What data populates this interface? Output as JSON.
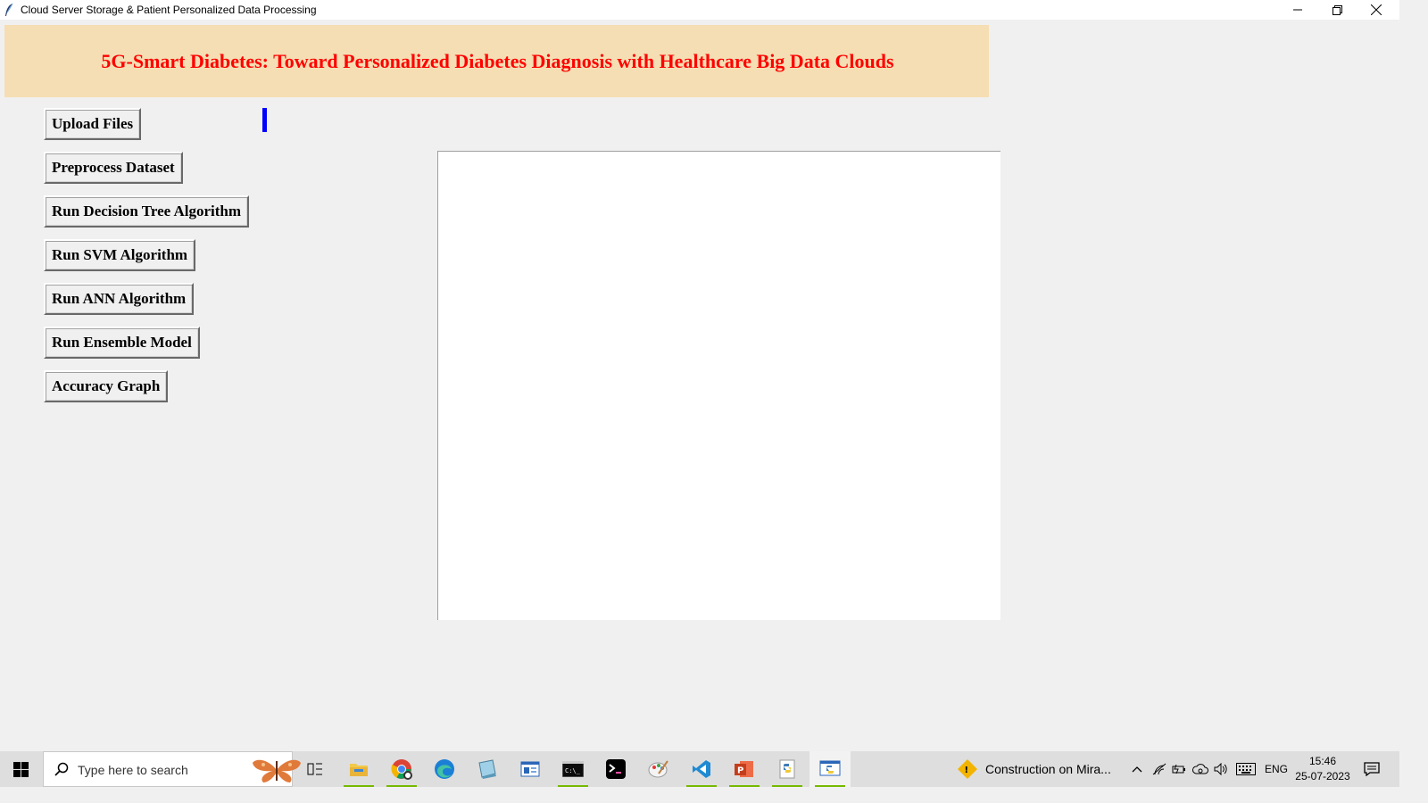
{
  "window": {
    "title": "Cloud Server Storage & Patient Personalized Data Processing",
    "controls": [
      "minimize",
      "restore",
      "close"
    ]
  },
  "header": {
    "title": "5G-Smart Diabetes: Toward Personalized Diabetes Diagnosis with Healthcare Big Data Clouds",
    "background": "#f5deb3",
    "color": "#ff0000"
  },
  "buttons": {
    "upload": "Upload Files",
    "preprocess": "Preprocess Dataset",
    "decision_tree": "Run Decision Tree Algorithm",
    "svm": "Run SVM Algorithm",
    "ann": "Run ANN Algorithm",
    "ensemble": "Run Ensemble Model",
    "accuracy": "Accuracy Graph"
  },
  "output": {
    "text": ""
  },
  "taskbar": {
    "search_placeholder": "Type here to search",
    "pinned_icons": [
      "task-view-icon",
      "file-explorer-icon",
      "chrome-icon",
      "edge-icon",
      "notepad-icon",
      "window-app-icon",
      "cmd-icon",
      "terminal-icon",
      "paint-icon",
      "vscode-icon",
      "powerpoint-icon",
      "python-idle-icon",
      "python-window-icon"
    ],
    "weather_text": "Construction on Mira...",
    "language": "ENG",
    "time": "15:46",
    "date": "25-07-2023"
  }
}
